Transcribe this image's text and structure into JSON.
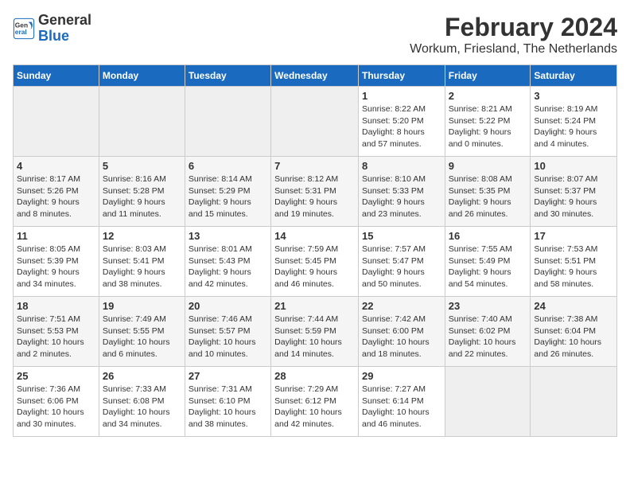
{
  "header": {
    "logo_line1": "General",
    "logo_line2": "Blue",
    "month": "February 2024",
    "location": "Workum, Friesland, The Netherlands"
  },
  "days_of_week": [
    "Sunday",
    "Monday",
    "Tuesday",
    "Wednesday",
    "Thursday",
    "Friday",
    "Saturday"
  ],
  "weeks": [
    [
      {
        "day": "",
        "info": ""
      },
      {
        "day": "",
        "info": ""
      },
      {
        "day": "",
        "info": ""
      },
      {
        "day": "",
        "info": ""
      },
      {
        "day": "1",
        "info": "Sunrise: 8:22 AM\nSunset: 5:20 PM\nDaylight: 8 hours\nand 57 minutes."
      },
      {
        "day": "2",
        "info": "Sunrise: 8:21 AM\nSunset: 5:22 PM\nDaylight: 9 hours\nand 0 minutes."
      },
      {
        "day": "3",
        "info": "Sunrise: 8:19 AM\nSunset: 5:24 PM\nDaylight: 9 hours\nand 4 minutes."
      }
    ],
    [
      {
        "day": "4",
        "info": "Sunrise: 8:17 AM\nSunset: 5:26 PM\nDaylight: 9 hours\nand 8 minutes."
      },
      {
        "day": "5",
        "info": "Sunrise: 8:16 AM\nSunset: 5:28 PM\nDaylight: 9 hours\nand 11 minutes."
      },
      {
        "day": "6",
        "info": "Sunrise: 8:14 AM\nSunset: 5:29 PM\nDaylight: 9 hours\nand 15 minutes."
      },
      {
        "day": "7",
        "info": "Sunrise: 8:12 AM\nSunset: 5:31 PM\nDaylight: 9 hours\nand 19 minutes."
      },
      {
        "day": "8",
        "info": "Sunrise: 8:10 AM\nSunset: 5:33 PM\nDaylight: 9 hours\nand 23 minutes."
      },
      {
        "day": "9",
        "info": "Sunrise: 8:08 AM\nSunset: 5:35 PM\nDaylight: 9 hours\nand 26 minutes."
      },
      {
        "day": "10",
        "info": "Sunrise: 8:07 AM\nSunset: 5:37 PM\nDaylight: 9 hours\nand 30 minutes."
      }
    ],
    [
      {
        "day": "11",
        "info": "Sunrise: 8:05 AM\nSunset: 5:39 PM\nDaylight: 9 hours\nand 34 minutes."
      },
      {
        "day": "12",
        "info": "Sunrise: 8:03 AM\nSunset: 5:41 PM\nDaylight: 9 hours\nand 38 minutes."
      },
      {
        "day": "13",
        "info": "Sunrise: 8:01 AM\nSunset: 5:43 PM\nDaylight: 9 hours\nand 42 minutes."
      },
      {
        "day": "14",
        "info": "Sunrise: 7:59 AM\nSunset: 5:45 PM\nDaylight: 9 hours\nand 46 minutes."
      },
      {
        "day": "15",
        "info": "Sunrise: 7:57 AM\nSunset: 5:47 PM\nDaylight: 9 hours\nand 50 minutes."
      },
      {
        "day": "16",
        "info": "Sunrise: 7:55 AM\nSunset: 5:49 PM\nDaylight: 9 hours\nand 54 minutes."
      },
      {
        "day": "17",
        "info": "Sunrise: 7:53 AM\nSunset: 5:51 PM\nDaylight: 9 hours\nand 58 minutes."
      }
    ],
    [
      {
        "day": "18",
        "info": "Sunrise: 7:51 AM\nSunset: 5:53 PM\nDaylight: 10 hours\nand 2 minutes."
      },
      {
        "day": "19",
        "info": "Sunrise: 7:49 AM\nSunset: 5:55 PM\nDaylight: 10 hours\nand 6 minutes."
      },
      {
        "day": "20",
        "info": "Sunrise: 7:46 AM\nSunset: 5:57 PM\nDaylight: 10 hours\nand 10 minutes."
      },
      {
        "day": "21",
        "info": "Sunrise: 7:44 AM\nSunset: 5:59 PM\nDaylight: 10 hours\nand 14 minutes."
      },
      {
        "day": "22",
        "info": "Sunrise: 7:42 AM\nSunset: 6:00 PM\nDaylight: 10 hours\nand 18 minutes."
      },
      {
        "day": "23",
        "info": "Sunrise: 7:40 AM\nSunset: 6:02 PM\nDaylight: 10 hours\nand 22 minutes."
      },
      {
        "day": "24",
        "info": "Sunrise: 7:38 AM\nSunset: 6:04 PM\nDaylight: 10 hours\nand 26 minutes."
      }
    ],
    [
      {
        "day": "25",
        "info": "Sunrise: 7:36 AM\nSunset: 6:06 PM\nDaylight: 10 hours\nand 30 minutes."
      },
      {
        "day": "26",
        "info": "Sunrise: 7:33 AM\nSunset: 6:08 PM\nDaylight: 10 hours\nand 34 minutes."
      },
      {
        "day": "27",
        "info": "Sunrise: 7:31 AM\nSunset: 6:10 PM\nDaylight: 10 hours\nand 38 minutes."
      },
      {
        "day": "28",
        "info": "Sunrise: 7:29 AM\nSunset: 6:12 PM\nDaylight: 10 hours\nand 42 minutes."
      },
      {
        "day": "29",
        "info": "Sunrise: 7:27 AM\nSunset: 6:14 PM\nDaylight: 10 hours\nand 46 minutes."
      },
      {
        "day": "",
        "info": ""
      },
      {
        "day": "",
        "info": ""
      }
    ]
  ]
}
